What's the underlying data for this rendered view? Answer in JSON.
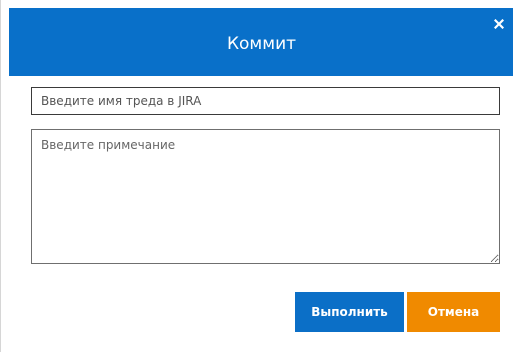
{
  "dialog": {
    "title": "Коммит",
    "close_glyph": "✕",
    "header_color": "#0970c9"
  },
  "form": {
    "thread_placeholder": "Введите имя треда в JIRA",
    "thread_value": "",
    "note_placeholder": "Введите примечание",
    "note_value": ""
  },
  "buttons": {
    "submit_label": "Выполнить",
    "submit_color": "#0b6fc7",
    "cancel_label": "Отмена",
    "cancel_color": "#f08a00"
  },
  "icons": {
    "close": "close-icon"
  }
}
